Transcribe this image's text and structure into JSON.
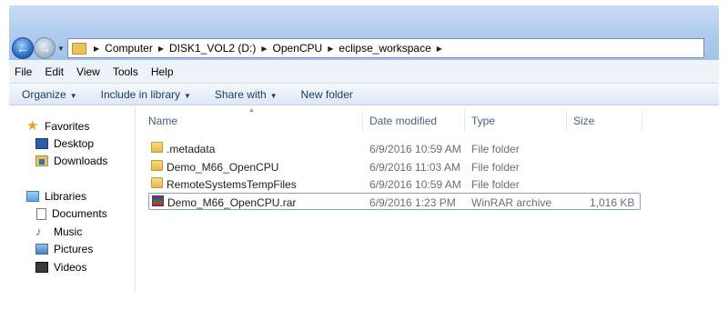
{
  "breadcrumb": [
    "Computer",
    "DISK1_VOL2 (D:)",
    "OpenCPU",
    "eclipse_workspace"
  ],
  "menu": [
    "File",
    "Edit",
    "View",
    "Tools",
    "Help"
  ],
  "commands": {
    "organize": "Organize",
    "include_in_library": "Include in library",
    "share_with": "Share with",
    "new_folder": "New folder"
  },
  "nav": {
    "favorites": "Favorites",
    "desktop": "Desktop",
    "downloads": "Downloads",
    "libraries": "Libraries",
    "documents": "Documents",
    "music": "Music",
    "pictures": "Pictures",
    "videos": "Videos"
  },
  "columns": {
    "name": "Name",
    "date_modified": "Date modified",
    "type": "Type",
    "size": "Size"
  },
  "files": [
    {
      "name": ".metadata",
      "date": "6/9/2016 10:59 AM",
      "type": "File folder",
      "size": "",
      "icon": "folder-icon"
    },
    {
      "name": "Demo_M66_OpenCPU",
      "date": "6/9/2016 11:03 AM",
      "type": "File folder",
      "size": "",
      "icon": "folder-icon"
    },
    {
      "name": "RemoteSystemsTempFiles",
      "date": "6/9/2016 10:59 AM",
      "type": "File folder",
      "size": "",
      "icon": "folder-icon"
    },
    {
      "name": "Demo_M66_OpenCPU.rar",
      "date": "6/9/2016 1:23 PM",
      "type": "WinRAR archive",
      "size": "1,016 KB",
      "icon": "winrar-archive-icon"
    }
  ]
}
